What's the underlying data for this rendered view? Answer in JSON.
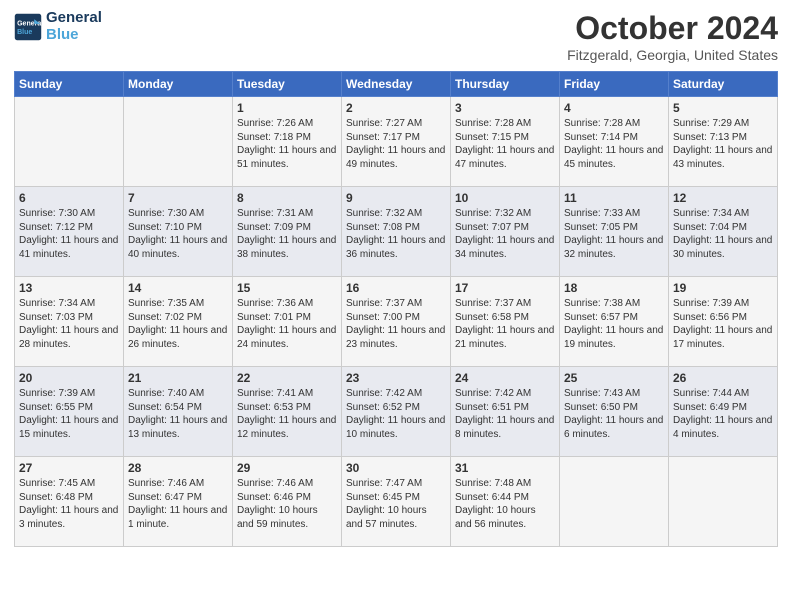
{
  "logo": {
    "line1": "General",
    "line2": "Blue"
  },
  "title": "October 2024",
  "subtitle": "Fitzgerald, Georgia, United States",
  "headers": [
    "Sunday",
    "Monday",
    "Tuesday",
    "Wednesday",
    "Thursday",
    "Friday",
    "Saturday"
  ],
  "weeks": [
    [
      {
        "day": "",
        "info": ""
      },
      {
        "day": "",
        "info": ""
      },
      {
        "day": "1",
        "info": "Sunrise: 7:26 AM\nSunset: 7:18 PM\nDaylight: 11 hours and 51 minutes."
      },
      {
        "day": "2",
        "info": "Sunrise: 7:27 AM\nSunset: 7:17 PM\nDaylight: 11 hours and 49 minutes."
      },
      {
        "day": "3",
        "info": "Sunrise: 7:28 AM\nSunset: 7:15 PM\nDaylight: 11 hours and 47 minutes."
      },
      {
        "day": "4",
        "info": "Sunrise: 7:28 AM\nSunset: 7:14 PM\nDaylight: 11 hours and 45 minutes."
      },
      {
        "day": "5",
        "info": "Sunrise: 7:29 AM\nSunset: 7:13 PM\nDaylight: 11 hours and 43 minutes."
      }
    ],
    [
      {
        "day": "6",
        "info": "Sunrise: 7:30 AM\nSunset: 7:12 PM\nDaylight: 11 hours and 41 minutes."
      },
      {
        "day": "7",
        "info": "Sunrise: 7:30 AM\nSunset: 7:10 PM\nDaylight: 11 hours and 40 minutes."
      },
      {
        "day": "8",
        "info": "Sunrise: 7:31 AM\nSunset: 7:09 PM\nDaylight: 11 hours and 38 minutes."
      },
      {
        "day": "9",
        "info": "Sunrise: 7:32 AM\nSunset: 7:08 PM\nDaylight: 11 hours and 36 minutes."
      },
      {
        "day": "10",
        "info": "Sunrise: 7:32 AM\nSunset: 7:07 PM\nDaylight: 11 hours and 34 minutes."
      },
      {
        "day": "11",
        "info": "Sunrise: 7:33 AM\nSunset: 7:05 PM\nDaylight: 11 hours and 32 minutes."
      },
      {
        "day": "12",
        "info": "Sunrise: 7:34 AM\nSunset: 7:04 PM\nDaylight: 11 hours and 30 minutes."
      }
    ],
    [
      {
        "day": "13",
        "info": "Sunrise: 7:34 AM\nSunset: 7:03 PM\nDaylight: 11 hours and 28 minutes."
      },
      {
        "day": "14",
        "info": "Sunrise: 7:35 AM\nSunset: 7:02 PM\nDaylight: 11 hours and 26 minutes."
      },
      {
        "day": "15",
        "info": "Sunrise: 7:36 AM\nSunset: 7:01 PM\nDaylight: 11 hours and 24 minutes."
      },
      {
        "day": "16",
        "info": "Sunrise: 7:37 AM\nSunset: 7:00 PM\nDaylight: 11 hours and 23 minutes."
      },
      {
        "day": "17",
        "info": "Sunrise: 7:37 AM\nSunset: 6:58 PM\nDaylight: 11 hours and 21 minutes."
      },
      {
        "day": "18",
        "info": "Sunrise: 7:38 AM\nSunset: 6:57 PM\nDaylight: 11 hours and 19 minutes."
      },
      {
        "day": "19",
        "info": "Sunrise: 7:39 AM\nSunset: 6:56 PM\nDaylight: 11 hours and 17 minutes."
      }
    ],
    [
      {
        "day": "20",
        "info": "Sunrise: 7:39 AM\nSunset: 6:55 PM\nDaylight: 11 hours and 15 minutes."
      },
      {
        "day": "21",
        "info": "Sunrise: 7:40 AM\nSunset: 6:54 PM\nDaylight: 11 hours and 13 minutes."
      },
      {
        "day": "22",
        "info": "Sunrise: 7:41 AM\nSunset: 6:53 PM\nDaylight: 11 hours and 12 minutes."
      },
      {
        "day": "23",
        "info": "Sunrise: 7:42 AM\nSunset: 6:52 PM\nDaylight: 11 hours and 10 minutes."
      },
      {
        "day": "24",
        "info": "Sunrise: 7:42 AM\nSunset: 6:51 PM\nDaylight: 11 hours and 8 minutes."
      },
      {
        "day": "25",
        "info": "Sunrise: 7:43 AM\nSunset: 6:50 PM\nDaylight: 11 hours and 6 minutes."
      },
      {
        "day": "26",
        "info": "Sunrise: 7:44 AM\nSunset: 6:49 PM\nDaylight: 11 hours and 4 minutes."
      }
    ],
    [
      {
        "day": "27",
        "info": "Sunrise: 7:45 AM\nSunset: 6:48 PM\nDaylight: 11 hours and 3 minutes."
      },
      {
        "day": "28",
        "info": "Sunrise: 7:46 AM\nSunset: 6:47 PM\nDaylight: 11 hours and 1 minute."
      },
      {
        "day": "29",
        "info": "Sunrise: 7:46 AM\nSunset: 6:46 PM\nDaylight: 10 hours and 59 minutes."
      },
      {
        "day": "30",
        "info": "Sunrise: 7:47 AM\nSunset: 6:45 PM\nDaylight: 10 hours and 57 minutes."
      },
      {
        "day": "31",
        "info": "Sunrise: 7:48 AM\nSunset: 6:44 PM\nDaylight: 10 hours and 56 minutes."
      },
      {
        "day": "",
        "info": ""
      },
      {
        "day": "",
        "info": ""
      }
    ]
  ]
}
